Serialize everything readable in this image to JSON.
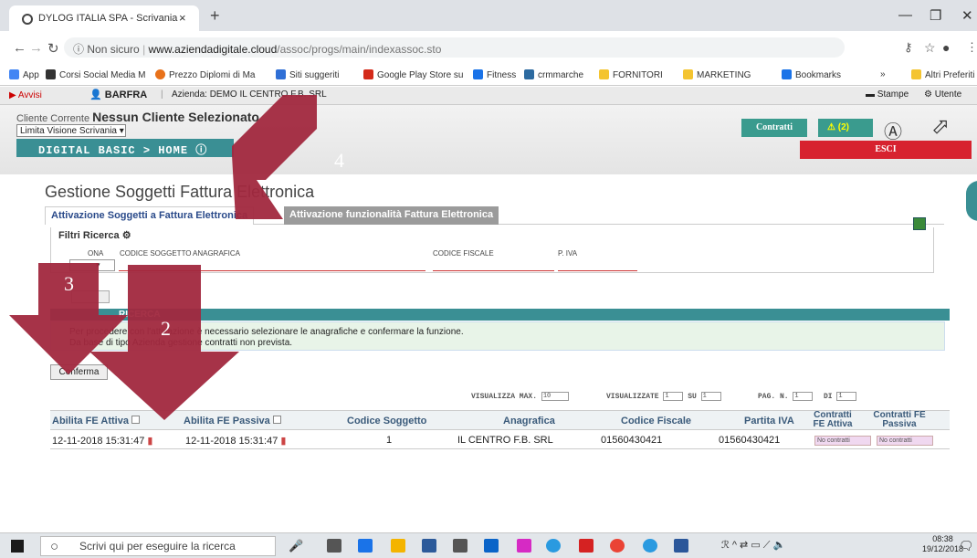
{
  "browser": {
    "tab_title": "DYLOG ITALIA SPA - Scrivania",
    "new_tab": "+",
    "url_notsecure": "Non sicuro",
    "url_domain": "www.aziendadigitale.cloud",
    "url_path": "/assoc/progs/main/indexassoc.sto",
    "bookmarks": [
      {
        "label": "App",
        "color": "#4285f4"
      },
      {
        "label": "Corsi Social Media M",
        "color": "#333333"
      },
      {
        "label": "Prezzo Diplomi di Ma",
        "color": "#e8711a"
      },
      {
        "label": "Siti suggeriti",
        "color": "#2f6fd6"
      },
      {
        "label": "Google Play Store su",
        "color": "#d42a1a"
      },
      {
        "label": "Fitness",
        "color": "#1a73e8"
      },
      {
        "label": "crmmarche",
        "color": "#2c6aa0"
      },
      {
        "label": "FORNITORI",
        "color": "#f4c430"
      },
      {
        "label": "MARKETING",
        "color": "#f4c430"
      },
      {
        "label": "Bookmarks",
        "color": "#1a73e8"
      }
    ],
    "more_label": "»",
    "altri": "Altri Preferiti"
  },
  "appbar": {
    "avvisi": "Avvisi",
    "user": "BARFRA",
    "azienda": "Azienda: DEMO IL CENTRO F.B. SRL",
    "stampe": "Stampe",
    "utente": "Utente"
  },
  "header": {
    "cliente_label": "Cliente Corrente",
    "cliente_value": "Nessun Cliente Selezionato",
    "limita": "Limita Visione Scrivania",
    "breadcrumb": "DIGITAL BASIC > HOME",
    "contratti": "Contratti",
    "alert_count": "(2)",
    "esci": "ESCI"
  },
  "page": {
    "title": "Gestione Soggetti Fattura Elettronica",
    "tab_active": "Attivazione Soggetti a Fattura Elettronica",
    "tab_other": "Attivazione funzionalità Fattura Elettronica",
    "filtri": "Filtri Ricerca",
    "filter_labels": [
      "ONA",
      "CODICE SOGGETTO",
      "ANAGRAFICA",
      "CODICE FISCALE",
      "P. IVA"
    ],
    "ricerca_bar": "RICERCA",
    "msg_line1": "Per procedere con l'attivazione è necessario selezionare le anagrafiche e confermare la funzione.",
    "msg_line2": "Da base di tipo Azienda gestione contratti non prevista.",
    "conferma": "Conferma",
    "visualizza_max": "VISUALIZZA MAX.",
    "visualizza_max_val": "10",
    "visualizzate": "VISUALIZZATE",
    "visualizzate_val": "1",
    "su": "SU",
    "su_val": "1",
    "pag": "PAG. N.",
    "pag_val": "1",
    "di": "DI",
    "di_val": "1"
  },
  "table": {
    "headers": [
      "Abilita FE Attiva",
      "Abilita FE Passiva",
      "Codice Soggetto",
      "Anagrafica",
      "Codice Fiscale",
      "Partita IVA",
      "Contratti FE Attiva",
      "Contratti FE Passiva"
    ],
    "row": {
      "attiva": "12-11-2018 15:31:47",
      "passiva": "12-11-2018 15:31:47",
      "codice": "1",
      "anagrafica": "IL CENTRO F.B. SRL",
      "cf": "01560430421",
      "piva": "01560430421",
      "c_attiva": "No contratti",
      "c_passiva": "No contratti"
    }
  },
  "arrows": {
    "a2": "2",
    "a3": "3",
    "a4": "4",
    "color": "#a1283e"
  },
  "taskbar": {
    "search": "Scrivi qui per eseguire la ricerca",
    "time": "08:38",
    "date": "19/12/2018"
  }
}
